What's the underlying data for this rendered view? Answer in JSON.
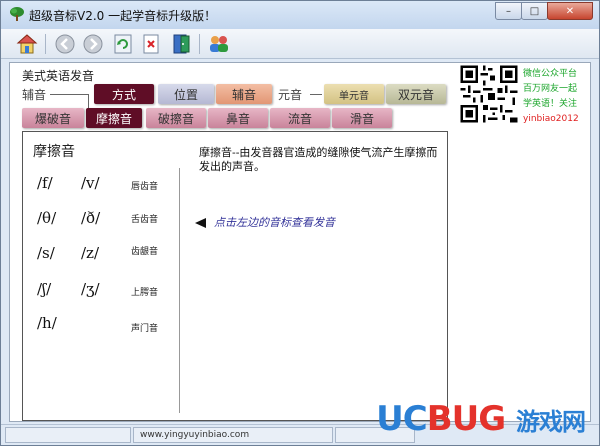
{
  "window": {
    "title": "超级音标V2.0    一起学音标升级版！",
    "controls": {
      "minimize": "–",
      "maximize": "□",
      "close": "✕"
    }
  },
  "toolbar": {
    "buttons": [
      {
        "name": "home-button",
        "icon": "home-icon"
      },
      {
        "name": "back-button",
        "icon": "arrow-left-icon"
      },
      {
        "name": "forward-button",
        "icon": "arrow-right-icon"
      },
      {
        "name": "refresh-button",
        "icon": "refresh-icon"
      },
      {
        "name": "delete-button",
        "icon": "delete-doc-icon"
      },
      {
        "name": "exit-button",
        "icon": "door-icon"
      },
      {
        "name": "users-button",
        "icon": "users-icon"
      }
    ]
  },
  "header": {
    "section_title": "美式英语发音",
    "row1_label": "辅音",
    "row1_label2": "元音",
    "row1_tabs": [
      {
        "label": "方式",
        "active": true
      },
      {
        "label": "位置",
        "active": false
      },
      {
        "label": "辅音",
        "active": false
      },
      {
        "label": "单元音",
        "active": false
      },
      {
        "label": "双元音",
        "active": false
      }
    ],
    "row2_tabs": [
      {
        "label": "爆破音",
        "active": false
      },
      {
        "label": "摩擦音",
        "active": true
      },
      {
        "label": "破擦音",
        "active": false
      },
      {
        "label": "鼻音",
        "active": false
      },
      {
        "label": "流音",
        "active": false
      },
      {
        "label": "滑音",
        "active": false
      }
    ]
  },
  "promo": {
    "lines": [
      "微信公众平台",
      "百万网友一起",
      "学英语！关注",
      "yinbiao2012"
    ]
  },
  "panel": {
    "title": "摩擦音",
    "phonemes": [
      {
        "a": "/f/",
        "b": "/v/",
        "label": "唇齿音"
      },
      {
        "a": "/θ/",
        "b": "/ð/",
        "label": "舌齿音"
      },
      {
        "a": "/s/",
        "b": "/z/",
        "label": "齿龈音"
      },
      {
        "a": "/ʃ/",
        "b": "/ʒ/",
        "label": "上腭音"
      },
      {
        "a": "/h/",
        "b": "",
        "label": "声门音"
      }
    ],
    "description": "摩擦音--由发音器官造成的缝隙使气流产生摩擦而发出的声音。",
    "hint": "点击左边的音标查看发音"
  },
  "statusbar": {
    "cell1": "",
    "cell2": "www.yingyuyinbiao.com",
    "cell3": ""
  },
  "watermark": {
    "brand_uc": "UC",
    "brand_bug": "BUG",
    "brand_cn": "游戏网",
    "domain": ".com"
  },
  "colors": {
    "active_tab": "#5f0d26",
    "promo_green": "#1aa52a",
    "promo_red": "#e02020",
    "hint_blue": "#333399"
  }
}
